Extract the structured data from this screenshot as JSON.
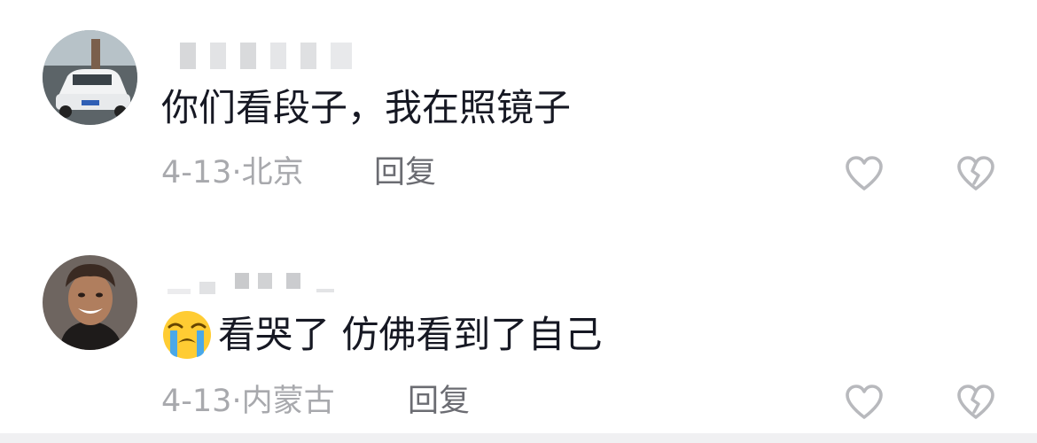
{
  "comments": [
    {
      "text": "你们看段子，我在照镜子",
      "date": "4-13",
      "separator": "·",
      "location": "北京",
      "reply_label": "回复",
      "avatar_icon": "car-photo-avatar",
      "like_icon": "heart-outline-icon",
      "dislike_icon": "broken-heart-icon"
    },
    {
      "emoji": "loudly-crying-face-emoji",
      "text": "看哭了 仿佛看到了自己",
      "date": "4-13",
      "separator": "·",
      "location": "内蒙古",
      "reply_label": "回复",
      "avatar_icon": "smiling-person-avatar",
      "like_icon": "heart-outline-icon",
      "dislike_icon": "broken-heart-icon"
    }
  ],
  "colors": {
    "text": "#161823",
    "meta": "#a8a9ad",
    "reply": "#6b6c72",
    "icon": "#b8b9bd"
  }
}
